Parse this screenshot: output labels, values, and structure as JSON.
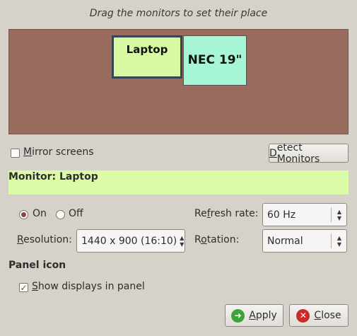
{
  "instruction": "Drag the monitors to set their place",
  "monitors": [
    {
      "name": "Laptop",
      "color": "#d6f9a2",
      "selected": true
    },
    {
      "name": "NEC 19\"",
      "color": "#a6f6d6",
      "selected": false
    }
  ],
  "arrange_area_color": "#986b5c",
  "mirror": {
    "label_first": "M",
    "label_rest": "irror screens",
    "checked": false
  },
  "detect_button": {
    "label_first": "D",
    "label_rest": "etect Monitors"
  },
  "monitor_header": {
    "text": "Monitor: Laptop",
    "color": "#dbfba9"
  },
  "power": {
    "on_label": "On",
    "off_label": "Off",
    "selected": "on"
  },
  "refresh": {
    "label_pre": "Re",
    "label_u": "f",
    "label_post": "resh rate:",
    "value": "60 Hz"
  },
  "resolution": {
    "label_u": "R",
    "label_post": "esolution:",
    "value": "1440 x 900 (16:10)"
  },
  "rotation": {
    "label_pre": "R",
    "label_u": "o",
    "label_post": "tation:",
    "value": "Normal"
  },
  "panel_icon": {
    "title": "Panel icon",
    "show_label_first": "S",
    "show_label_rest": "how displays in panel",
    "checked": true
  },
  "apply_button": {
    "label_first": "A",
    "label_rest": "pply",
    "icon": "apply-arrow-icon",
    "icon_color": "#3aa53a"
  },
  "close_button": {
    "label_first": "C",
    "label_rest": "lose",
    "icon": "close-x-icon",
    "icon_color": "#cc2a2a"
  }
}
